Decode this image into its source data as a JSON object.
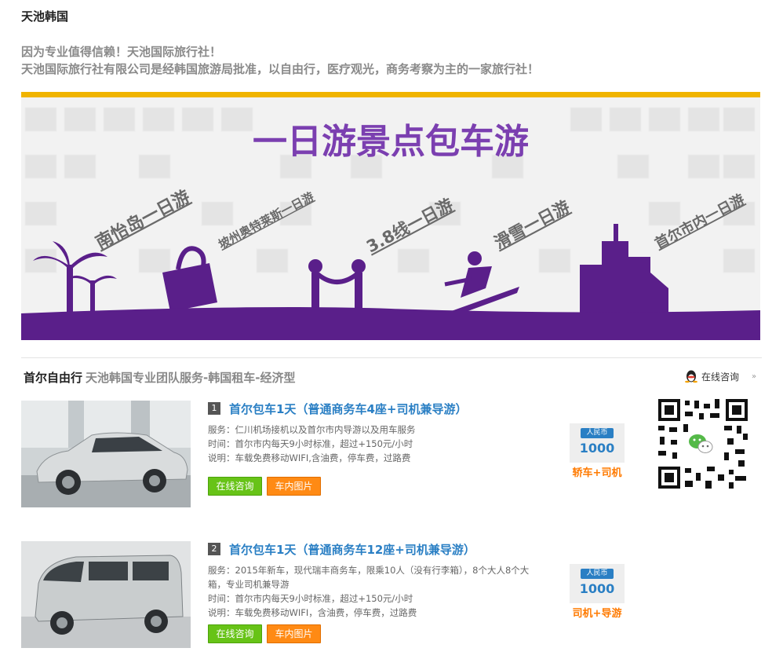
{
  "site": {
    "title": "天池韩国",
    "slogan_line1": "因为专业值得信赖！天池国际旅行社！",
    "slogan_line2": "天池国际旅行社有限公司是经韩国旅游局批准，以自由行，医疗观光，商务考察为主的一家旅行社！"
  },
  "banner": {
    "headline": "一日游景点包车游",
    "tours": [
      "南怡岛一日游",
      "坡州奥特莱斯一日游",
      "3.8线一日游",
      "滑雪一日游",
      "首尔市内一日游"
    ],
    "colors": {
      "purple": "#5a1f8a",
      "gold": "#f0b400"
    }
  },
  "section": {
    "title": "首尔自由行",
    "subtitle": "天池韩国专业团队服务-韩国租车-经济型",
    "online_consult": "在线咨询",
    "more": "»"
  },
  "products": [
    {
      "num": "1",
      "title": "首尔包车1天（普通商务车4座+司机兼导游）",
      "service": "服务：仁川机场接机以及首尔市内导游以及用车服务",
      "time": "时间：首尔市内每天9小时标准，超过+150元/小时",
      "note": "说明：车载免费移动WIFI,含油费，停车费，过路费",
      "consult_btn": "在线咨询",
      "photos_btn": "车内图片",
      "price_label": "人民币",
      "price": "1000",
      "price_note": "轿车+司机"
    },
    {
      "num": "2",
      "title": "首尔包车1天（普通商务车12座+司机兼导游）",
      "service": "服务：2015年新车，现代瑞丰商务车，限乘10人（没有行李箱），8个大人8个大箱，专业司机兼导游",
      "time": "时间：首尔市内每天9小时标准，超过+150元/小时",
      "note": "说明：车载免费移动WIFI，含油费，停车费，过路费",
      "consult_btn": "在线咨询",
      "photos_btn": "车内图片",
      "price_label": "人民币",
      "price": "1000",
      "price_note": "司机+导游"
    }
  ],
  "colors": {
    "link_blue": "#2a7fc4",
    "btn_green": "#67c317",
    "btn_orange": "#ff8a14",
    "price_note": "#ff7a00"
  }
}
